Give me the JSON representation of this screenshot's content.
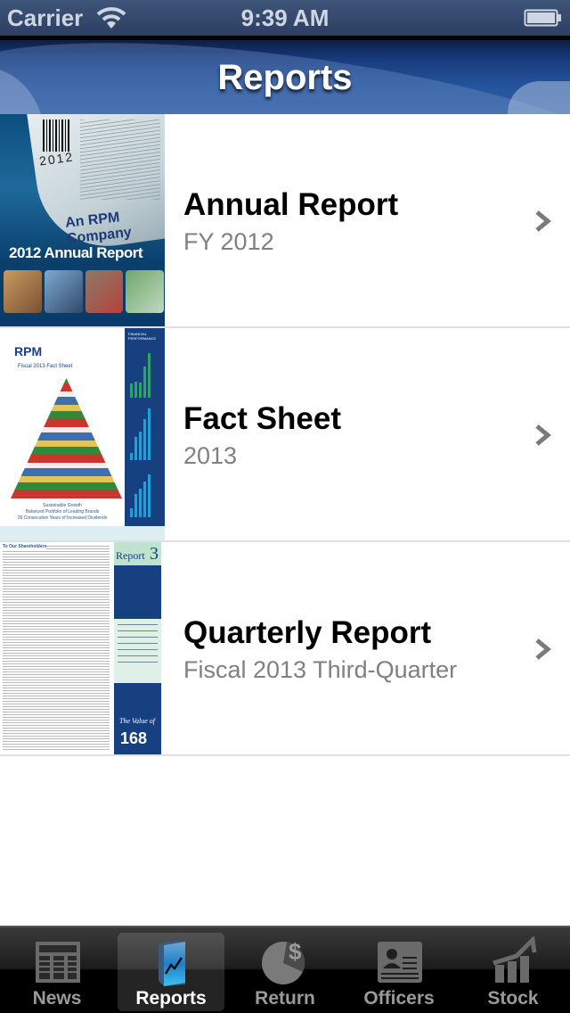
{
  "status_bar": {
    "carrier": "Carrier",
    "time": "9:39 AM",
    "wifi_icon": "wifi-icon",
    "battery_icon": "battery-icon"
  },
  "nav_bar": {
    "title": "Reports"
  },
  "reports": [
    {
      "title": "Annual Report",
      "subtitle": "FY 2012",
      "cover": {
        "heading": "2012 Annual Report",
        "company": "An RPM Company",
        "barcode_text": "2012"
      }
    },
    {
      "title": "Fact Sheet",
      "subtitle": "2013",
      "cover": {
        "logo": "RPM",
        "heading": "Fiscal 2013 Fact Sheet",
        "sidebar_title": "FINANCIAL PERFORMANCE",
        "tagline_1": "Sustainable Growth",
        "tagline_2": "Balanced Portfolio of Leading Brands",
        "tagline_3": "39 Consecutive Years of Increased Dividends"
      }
    },
    {
      "title": "Quarterly Report",
      "subtitle": "Fiscal 2013 Third-Quarter",
      "cover": {
        "heading": "To Our Shareholders",
        "badge_label": "Report",
        "badge_number": "3",
        "value_label": "The Value of",
        "value_number": "168"
      }
    }
  ],
  "tab_bar": {
    "tabs": [
      {
        "label": "News",
        "icon": "newspaper-icon",
        "active": false
      },
      {
        "label": "Reports",
        "icon": "report-book-icon",
        "active": true
      },
      {
        "label": "Return",
        "icon": "pie-dollar-icon",
        "active": false
      },
      {
        "label": "Officers",
        "icon": "id-card-icon",
        "active": false
      },
      {
        "label": "Stock",
        "icon": "stock-chart-icon",
        "active": false
      }
    ]
  },
  "colors": {
    "nav_blue": "#24539b",
    "cover_navy": "#16407f",
    "title_text": "#000000",
    "subtitle_text": "#808080",
    "chevron": "#7a7a7a",
    "tab_active_label": "#ffffff",
    "tab_inactive_label": "#9a9a9a"
  }
}
